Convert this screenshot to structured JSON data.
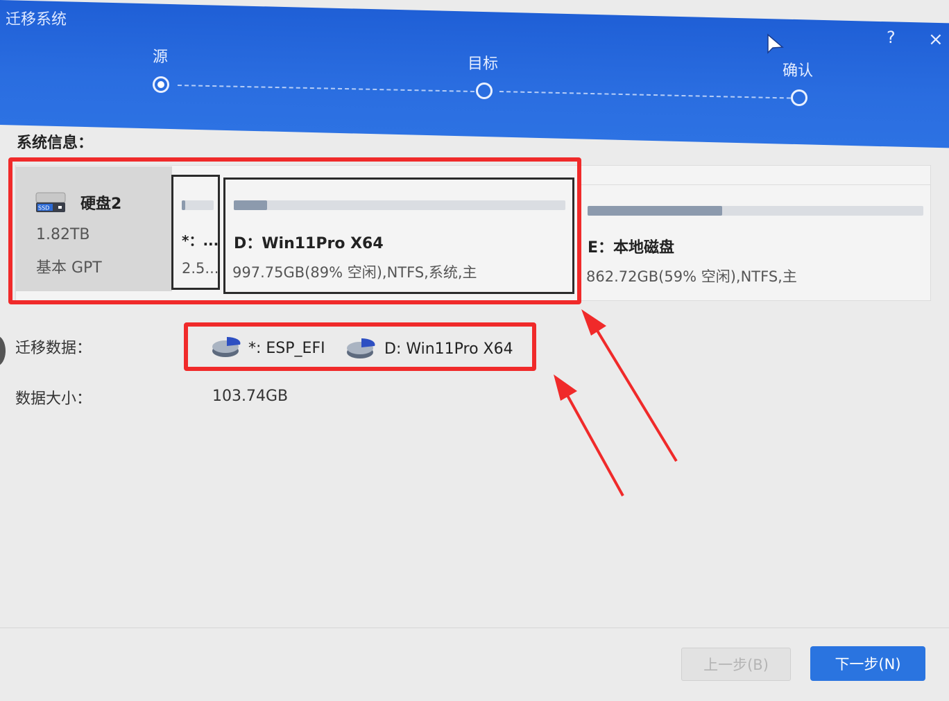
{
  "window": {
    "title": "迁移系统",
    "help_label": "?",
    "close_label": "×"
  },
  "steps": [
    {
      "label": "源",
      "state": "active"
    },
    {
      "label": "目标",
      "state": "pending"
    },
    {
      "label": "确认",
      "state": "pending"
    }
  ],
  "system_info": {
    "title": "系统信息：",
    "disk": {
      "name": "硬盘2",
      "badge": "SSD",
      "size": "1.82TB",
      "type": "基本 GPT"
    },
    "partitions": [
      {
        "name": "*：...",
        "info": "2.5...",
        "used_fraction": 0.1
      },
      {
        "name": "D：Win11Pro X64",
        "info": "997.75GB(89% 空闲),NTFS,系统,主",
        "used_fraction": 0.1
      },
      {
        "name": "E：本地磁盘",
        "info": "862.72GB(59% 空闲),NTFS,主",
        "used_fraction": 0.4
      }
    ]
  },
  "migrate": {
    "label": "迁移数据：",
    "items": [
      "*: ESP_EFI",
      "D: Win11Pro X64"
    ]
  },
  "data_size": {
    "label": "数据大小：",
    "value": "103.74GB"
  },
  "buttons": {
    "prev": "上一步(B)",
    "next": "下一步(N)"
  },
  "colors": {
    "header": "#2a6de0",
    "highlight": "#f02a2a",
    "primary_button": "#2a74e0"
  }
}
